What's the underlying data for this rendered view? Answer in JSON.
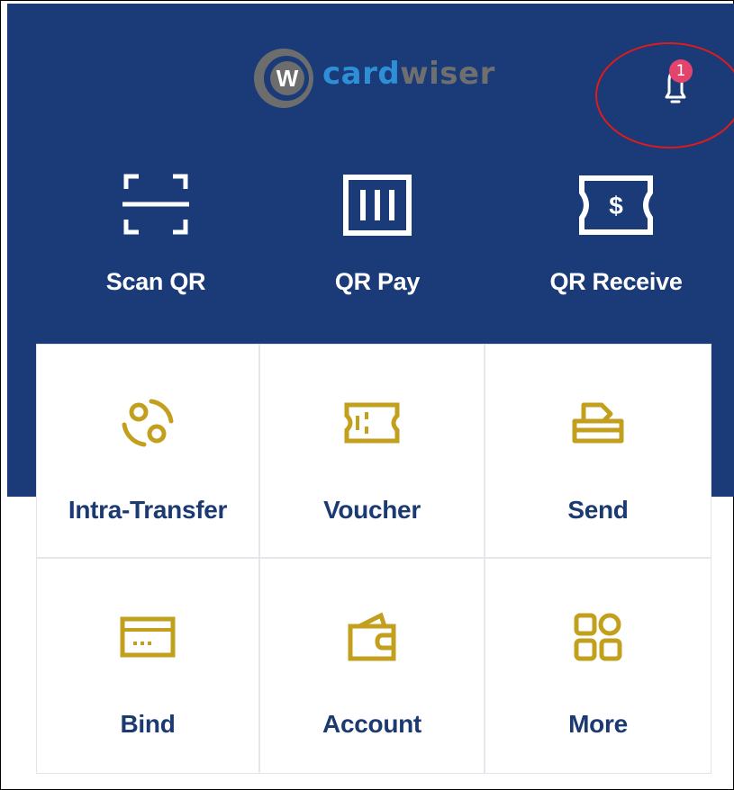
{
  "app": {
    "logo_left": "card",
    "logo_right": "wiser",
    "notification_count": "1"
  },
  "quick_actions": [
    {
      "label": "Scan QR",
      "icon": "scan-qr-icon"
    },
    {
      "label": "QR Pay",
      "icon": "qr-pay-icon"
    },
    {
      "label": "QR Receive",
      "icon": "qr-receive-icon"
    }
  ],
  "services": [
    {
      "label": "Intra-Transfer",
      "icon": "transfer-icon"
    },
    {
      "label": "Voucher",
      "icon": "voucher-icon"
    },
    {
      "label": "Send",
      "icon": "send-icon"
    },
    {
      "label": "Bind",
      "icon": "card-icon"
    },
    {
      "label": "Account",
      "icon": "wallet-icon"
    },
    {
      "label": "More",
      "icon": "more-icon"
    }
  ],
  "colors": {
    "header_bg": "#1a3a78",
    "icon_gold": "#c2a01e",
    "label_navy": "#1c3a72",
    "badge_pink": "#e2446b",
    "annotation_red": "#e01b1b"
  }
}
